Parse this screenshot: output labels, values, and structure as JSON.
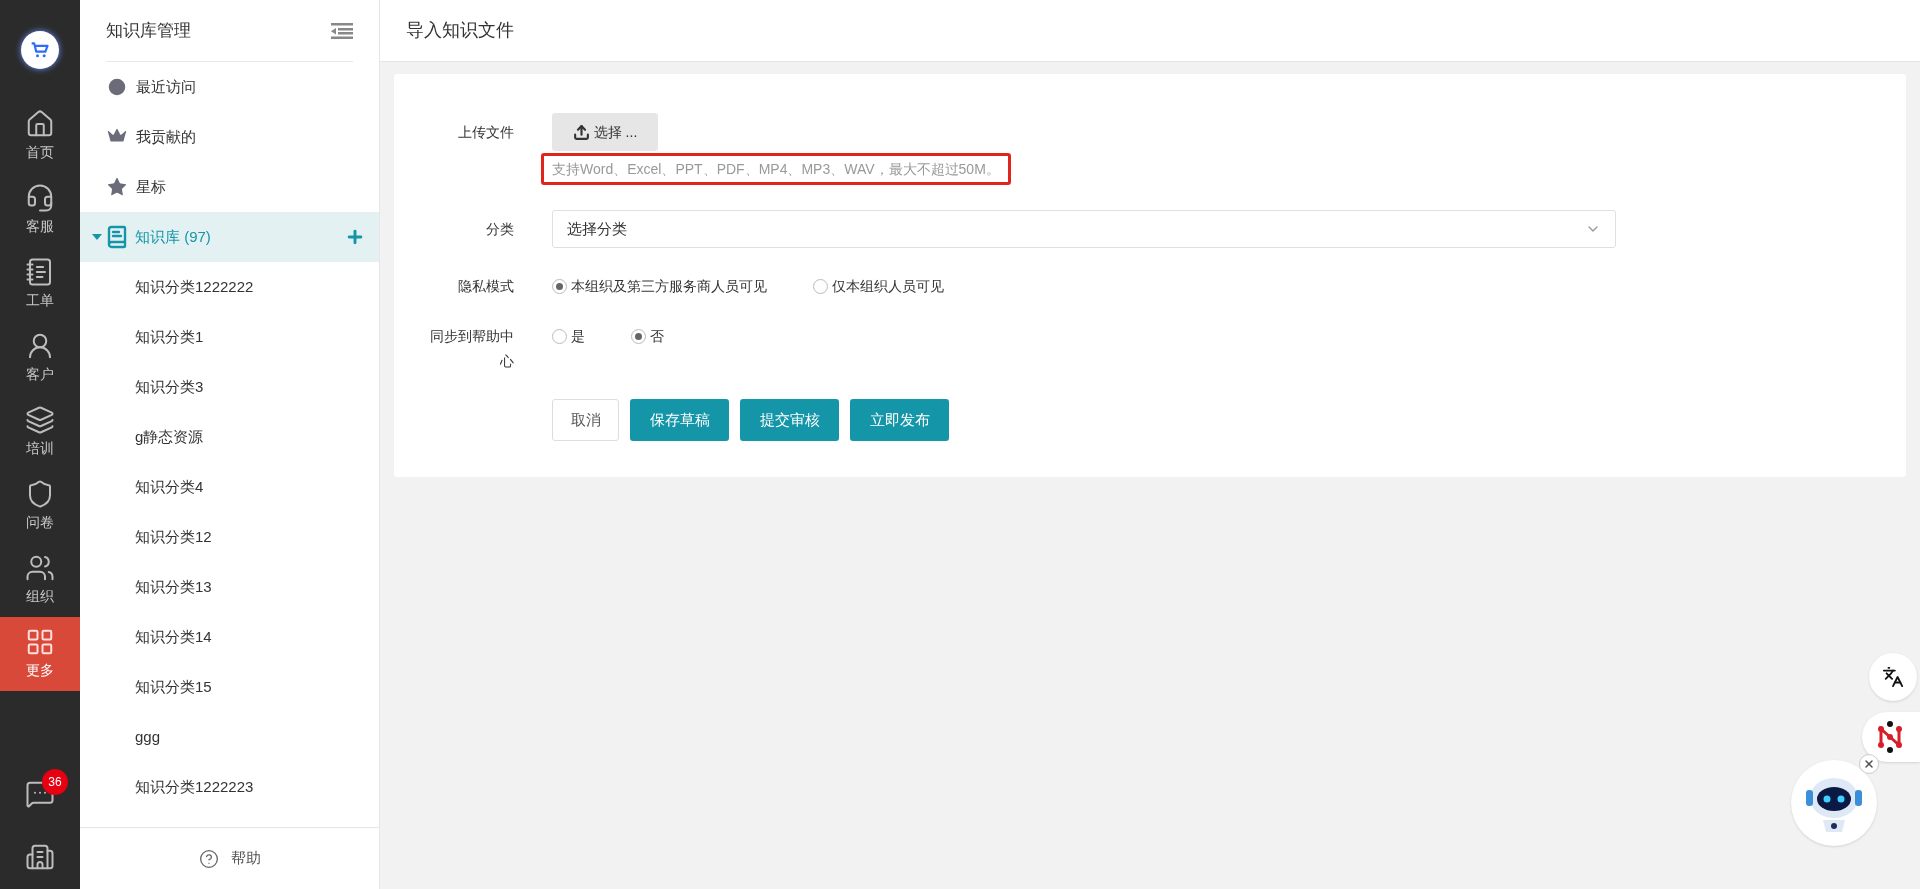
{
  "rail": {
    "items": [
      {
        "label": "首页",
        "selected": false
      },
      {
        "label": "客服",
        "selected": false
      },
      {
        "label": "工单",
        "selected": false
      },
      {
        "label": "客户",
        "selected": false
      },
      {
        "label": "培训",
        "selected": false
      },
      {
        "label": "问卷",
        "selected": false
      },
      {
        "label": "组织",
        "selected": false
      },
      {
        "label": "更多",
        "selected": true
      }
    ],
    "chat_badge": "36"
  },
  "sidebar": {
    "title": "知识库管理",
    "quick_items": [
      {
        "label": "最近访问"
      },
      {
        "label": "我贡献的"
      },
      {
        "label": "星标"
      }
    ],
    "library": {
      "label": "知识库 (97)",
      "expanded": true,
      "selected": true,
      "children": [
        {
          "label": "知识分类1222222"
        },
        {
          "label": "知识分类1"
        },
        {
          "label": "知识分类3"
        },
        {
          "label": "g静态资源"
        },
        {
          "label": "知识分类4"
        },
        {
          "label": "知识分类12"
        },
        {
          "label": "知识分类13"
        },
        {
          "label": "知识分类14"
        },
        {
          "label": "知识分类15"
        },
        {
          "label": "ggg"
        },
        {
          "label": "知识分类1222223"
        }
      ]
    },
    "help": "帮助"
  },
  "page_title": "导入知识文件",
  "form": {
    "upload": {
      "label": "上传文件",
      "button": "选择 ...",
      "hint": "支持Word、Excel、PPT、PDF、MP4、MP3、WAV，最大不超过50M。"
    },
    "category": {
      "label": "分类",
      "placeholder": "选择分类"
    },
    "privacy": {
      "label": "隐私模式",
      "options": [
        {
          "label": "本组织及第三方服务商人员可见",
          "selected": true
        },
        {
          "label": "仅本组织人员可见",
          "selected": false
        }
      ]
    },
    "sync": {
      "label": "同步到帮助中心",
      "options": [
        {
          "label": "是",
          "selected": false
        },
        {
          "label": "否",
          "selected": true
        }
      ]
    },
    "actions": [
      {
        "label": "取消",
        "kind": "default"
      },
      {
        "label": "保存草稿",
        "kind": "primary"
      },
      {
        "label": "提交审核",
        "kind": "primary"
      },
      {
        "label": "立即发布",
        "kind": "primary"
      }
    ]
  }
}
